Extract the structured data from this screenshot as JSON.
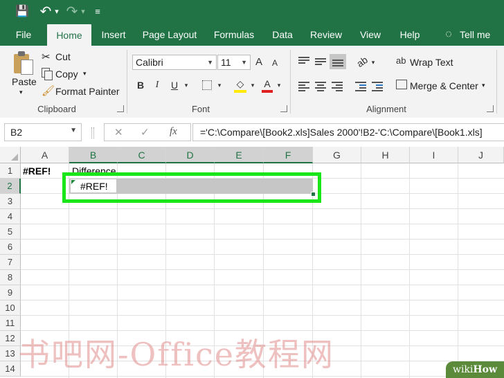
{
  "qat": {
    "save": "💾",
    "undo": "↶",
    "undo_dd": "▾",
    "redo": "↷",
    "redo_dd": "▾",
    "customize": "≡"
  },
  "tabs": [
    "File",
    "Home",
    "Insert",
    "Page Layout",
    "Formulas",
    "Data",
    "Review",
    "View",
    "Help",
    "Tell me wh"
  ],
  "ribbon": {
    "clipboard": {
      "paste": "Paste",
      "cut": "Cut",
      "copy": "Copy",
      "format_painter": "Format Painter",
      "label": "Clipboard"
    },
    "font": {
      "name": "Calibri",
      "size": "11",
      "grow": "A",
      "shrink": "A",
      "bold": "B",
      "italic": "I",
      "underline": "U",
      "label": "Font"
    },
    "alignment": {
      "wrap_text": "Wrap Text",
      "merge_center": "Merge & Center",
      "label": "Alignment"
    }
  },
  "formula_bar": {
    "name_box": "B2",
    "cancel": "✕",
    "enter": "✓",
    "fx": "fx",
    "formula": "='C:\\Compare\\[Book2.xls]Sales 2000'!B2-'C:\\Compare\\[Book1.xls]"
  },
  "columns": [
    "A",
    "B",
    "C",
    "D",
    "E",
    "F",
    "G",
    "H",
    "I",
    "J"
  ],
  "rows": [
    "1",
    "2",
    "3",
    "4",
    "5",
    "6",
    "7",
    "8",
    "9",
    "10",
    "11",
    "12",
    "13",
    "14"
  ],
  "cells": {
    "A1": "#REF!",
    "B1": "Difference",
    "B2": "#REF!"
  },
  "colors": {
    "excel_green": "#217346",
    "highlight": "#19e619",
    "selection_fill": "#c6c6c6"
  },
  "watermark": "书吧网-Office教程网",
  "wikihow": {
    "wiki": "wiki",
    "how": "How"
  }
}
